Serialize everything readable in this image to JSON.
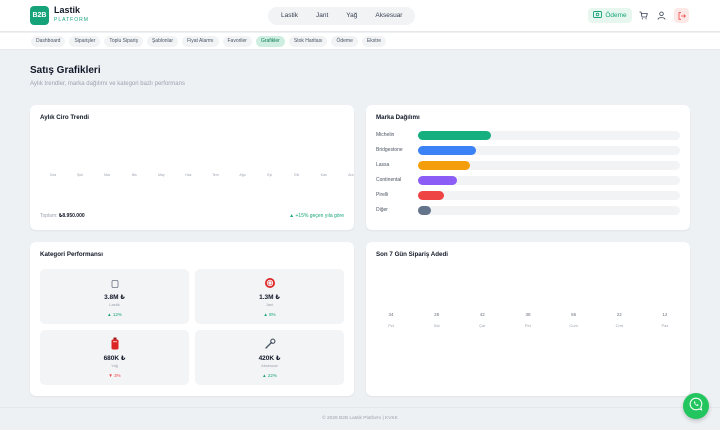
{
  "brand": {
    "logo_text": "B2B",
    "name": "Lastik",
    "tagline": "PLATFORM"
  },
  "top_nav": [
    "Lastik",
    "Jant",
    "Yağ",
    "Aksesuar"
  ],
  "header": {
    "order_label": "Ödeme",
    "icons": [
      "cart-icon",
      "user-icon",
      "logout-icon"
    ]
  },
  "tabs": [
    {
      "label": "Dashboard",
      "active": false
    },
    {
      "label": "Siparişler",
      "active": false
    },
    {
      "label": "Toplu Sipariş",
      "active": false
    },
    {
      "label": "Şablonlar",
      "active": false
    },
    {
      "label": "Fiyat Alarmı",
      "active": false
    },
    {
      "label": "Favoriler",
      "active": false
    },
    {
      "label": "Grafikler",
      "active": true
    },
    {
      "label": "Stok Haritası",
      "active": false
    },
    {
      "label": "Ödeme",
      "active": false
    },
    {
      "label": "Ekstre",
      "active": false
    }
  ],
  "page": {
    "title": "Satış Grafikleri",
    "subtitle": "Aylık trendler, marka dağılımı ve kategori bazlı performans"
  },
  "revenue": {
    "title": "Aylık Ciro Trendi",
    "months": [
      "Oca",
      "Şub",
      "Mar",
      "Nis",
      "May",
      "Haz",
      "Tem",
      "Ağu",
      "Eyl",
      "Eki",
      "Kas",
      "Ara"
    ],
    "total_label": "Toplam:",
    "total_value": "₺8.950.000",
    "growth": "▲ +15% geçen yıla göre"
  },
  "brands": {
    "title": "Marka Dağılımı",
    "items": [
      {
        "name": "Michelin",
        "share": 0.28,
        "color": "#16b07f"
      },
      {
        "name": "Bridgestone",
        "share": 0.22,
        "color": "#3b82f6"
      },
      {
        "name": "Lassa",
        "share": 0.2,
        "color": "#f59e0b"
      },
      {
        "name": "Continental",
        "share": 0.15,
        "color": "#8b5cf6"
      },
      {
        "name": "Pirelli",
        "share": 0.1,
        "color": "#ef4444"
      },
      {
        "name": "Diğer",
        "share": 0.05,
        "color": "#64748b"
      }
    ]
  },
  "categories": {
    "title": "Kategori Performansı",
    "items": [
      {
        "value": "3.8M ₺",
        "name": "Lastik",
        "change": "▲ 12%",
        "positive": true,
        "icon": "tire-square-icon"
      },
      {
        "value": "1.3M ₺",
        "name": "Jant",
        "change": "▲ 8%",
        "positive": true,
        "icon": "rim-icon"
      },
      {
        "value": "680K ₺",
        "name": "Yağ",
        "change": "▼ 3%",
        "positive": false,
        "icon": "oil-can-icon"
      },
      {
        "value": "420K ₺",
        "name": "Aksesuar",
        "change": "▲ 22%",
        "positive": true,
        "icon": "wrench-icon"
      }
    ]
  },
  "orders7": {
    "title": "Son 7 Gün Sipariş Adedi",
    "days": [
      {
        "day": "Pzt",
        "count": "34"
      },
      {
        "day": "Sal",
        "count": "28"
      },
      {
        "day": "Çar",
        "count": "42"
      },
      {
        "day": "Per",
        "count": "38"
      },
      {
        "day": "Cum",
        "count": "56"
      },
      {
        "day": "Cmt",
        "count": "22"
      },
      {
        "day": "Paz",
        "count": "12"
      }
    ]
  },
  "footer": {
    "text": "© 2026 B2B Lastik Platform  |  KVKK"
  },
  "colors": {
    "accent": "#16a37a",
    "whatsapp": "#22c55e",
    "negative": "#ef4444"
  }
}
